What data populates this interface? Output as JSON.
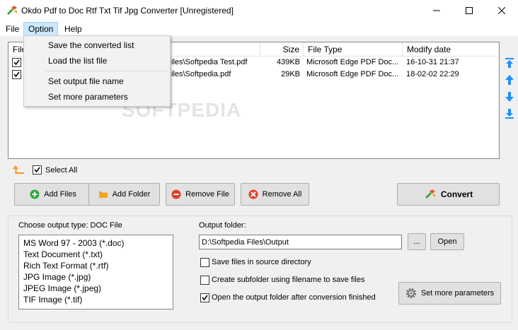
{
  "window": {
    "title": "Okdo Pdf to Doc Rtf Txt Tif Jpg Converter [Unregistered]",
    "minimize": "—",
    "maximize": "☐",
    "close": "✕"
  },
  "menubar": {
    "file": "File",
    "option": "Option",
    "help": "Help"
  },
  "option_menu": {
    "items": [
      "Save the converted list",
      "Load the list file",
      "Set output file name",
      "Set more parameters"
    ]
  },
  "file_list": {
    "columns": [
      "File",
      "",
      "Size",
      "File Type",
      "Modify date"
    ],
    "rows": [
      {
        "checked": true,
        "path": "iles\\Softpedia Test.pdf",
        "size": "439KB",
        "type": "Microsoft Edge PDF Doc...",
        "date": "16-10-31 21:37"
      },
      {
        "checked": true,
        "path": "iles\\Softpedia.pdf",
        "size": "29KB",
        "type": "Microsoft Edge PDF Doc...",
        "date": "18-02-02 22:29"
      }
    ],
    "watermark": "SOFTPEDIA"
  },
  "select_all": {
    "label": "Select All",
    "checked": true
  },
  "buttons": {
    "add_files": "Add Files",
    "add_folder": "Add Folder",
    "remove_file": "Remove File",
    "remove_all": "Remove All",
    "convert": "Convert",
    "browse": "...",
    "open": "Open",
    "set_more": "Set more parameters"
  },
  "output_type": {
    "label": "Choose output type:  DOC File",
    "options": [
      "MS Word 97 - 2003 (*.doc)",
      "Text Document (*.txt)",
      "Rich Text Format (*.rtf)",
      "JPG Image (*.jpg)",
      "JPEG Image (*.jpeg)",
      "TIF Image (*.tif)"
    ],
    "selected_index": 0
  },
  "output_folder": {
    "label": "Output folder:",
    "value": "D:\\Softpedia Files\\Output"
  },
  "options": [
    {
      "label": "Save files in source directory",
      "checked": false
    },
    {
      "label": "Create subfolder using filename to save files",
      "checked": false
    },
    {
      "label": "Open the output folder after conversion finished",
      "checked": true
    }
  ],
  "colors": {
    "accent_blue": "#1e90ff",
    "menu_highlight": "#cce8ff",
    "add_green": "#2eaa3c",
    "remove_red": "#e0402a",
    "folder_orange": "#f5a623"
  }
}
